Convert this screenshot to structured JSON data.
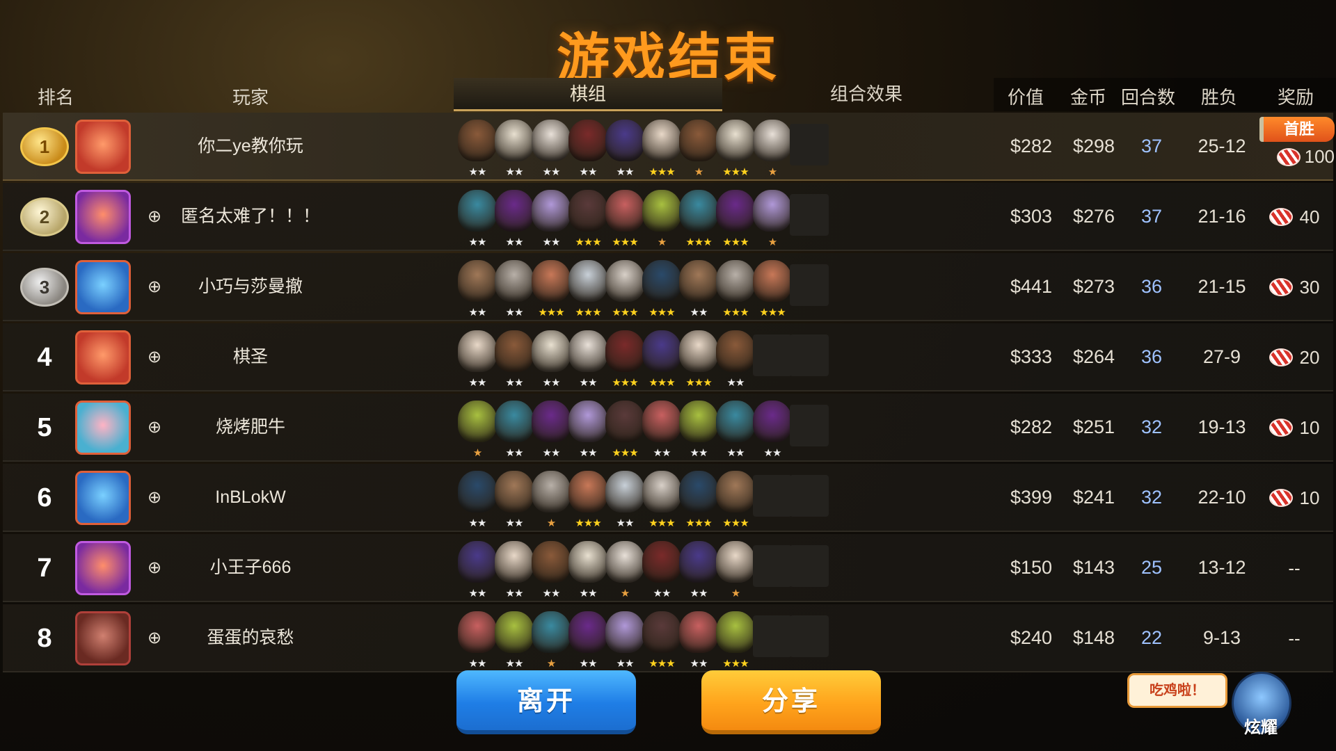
{
  "title": "游戏结束",
  "headers": {
    "rank": "排名",
    "player": "玩家",
    "lineups_tab": "棋组",
    "effects_tab": "组合效果",
    "value": "价值",
    "gold": "金币",
    "rounds": "回合数",
    "wl": "胜负",
    "reward": "奖励"
  },
  "rows": [
    {
      "rank": "1",
      "medal": "gold",
      "name": "你二ye教你玩",
      "value": "$282",
      "gold": "$298",
      "rounds": "37",
      "wl": "25-12",
      "reward_tag": "首胜",
      "reward": "100",
      "stars": [
        2,
        2,
        2,
        2,
        2,
        3,
        1,
        3,
        1
      ],
      "avatar": "red"
    },
    {
      "rank": "2",
      "medal": "silver",
      "name": "匿名太难了！！！",
      "value": "$303",
      "gold": "$276",
      "rounds": "37",
      "wl": "21-16",
      "reward": "40",
      "stars": [
        2,
        2,
        2,
        3,
        3,
        1,
        3,
        3,
        1
      ],
      "avatar": "purple"
    },
    {
      "rank": "3",
      "medal": "bronze",
      "name": "小巧与莎曼撤",
      "value": "$441",
      "gold": "$273",
      "rounds": "36",
      "wl": "21-15",
      "reward": "30",
      "stars": [
        2,
        2,
        3,
        3,
        3,
        3,
        2,
        3,
        3
      ],
      "avatar": "blue"
    },
    {
      "rank": "4",
      "name": "棋圣",
      "value": "$333",
      "gold": "$264",
      "rounds": "36",
      "wl": "27-9",
      "reward": "20",
      "stars": [
        2,
        2,
        2,
        2,
        3,
        3,
        3,
        2
      ],
      "avatar": "red"
    },
    {
      "rank": "5",
      "name": "烧烤肥牛",
      "value": "$282",
      "gold": "$251",
      "rounds": "32",
      "wl": "19-13",
      "reward": "10",
      "stars": [
        1,
        2,
        2,
        2,
        3,
        2,
        2,
        2,
        2
      ],
      "avatar": "teal"
    },
    {
      "rank": "6",
      "name": "InBLokW",
      "value": "$399",
      "gold": "$241",
      "rounds": "32",
      "wl": "22-10",
      "reward": "10",
      "stars": [
        2,
        2,
        1,
        3,
        2,
        3,
        3,
        3
      ],
      "avatar": "blue"
    },
    {
      "rank": "7",
      "name": "小王子666",
      "value": "$150",
      "gold": "$143",
      "rounds": "25",
      "wl": "13-12",
      "reward": "--",
      "stars": [
        2,
        2,
        2,
        2,
        1,
        2,
        2,
        1
      ],
      "avatar": "purple"
    },
    {
      "rank": "8",
      "name": "蛋蛋的哀愁",
      "value": "$240",
      "gold": "$148",
      "rounds": "22",
      "wl": "9-13",
      "reward": "--",
      "stars": [
        2,
        2,
        1,
        2,
        2,
        3,
        2,
        3
      ],
      "avatar": "maroon"
    }
  ],
  "buttons": {
    "leave": "离开",
    "share": "分享"
  },
  "bubble": "吃鸡啦！",
  "mascot_label": "炫耀",
  "icons": {
    "add_friend": "add-friend-icon",
    "reward": "candy-icon"
  },
  "colors": {
    "title": "#ff9a1e",
    "rounds": "#9fc2ff",
    "leave": "#1f7ee6",
    "share": "#ffa41c"
  }
}
